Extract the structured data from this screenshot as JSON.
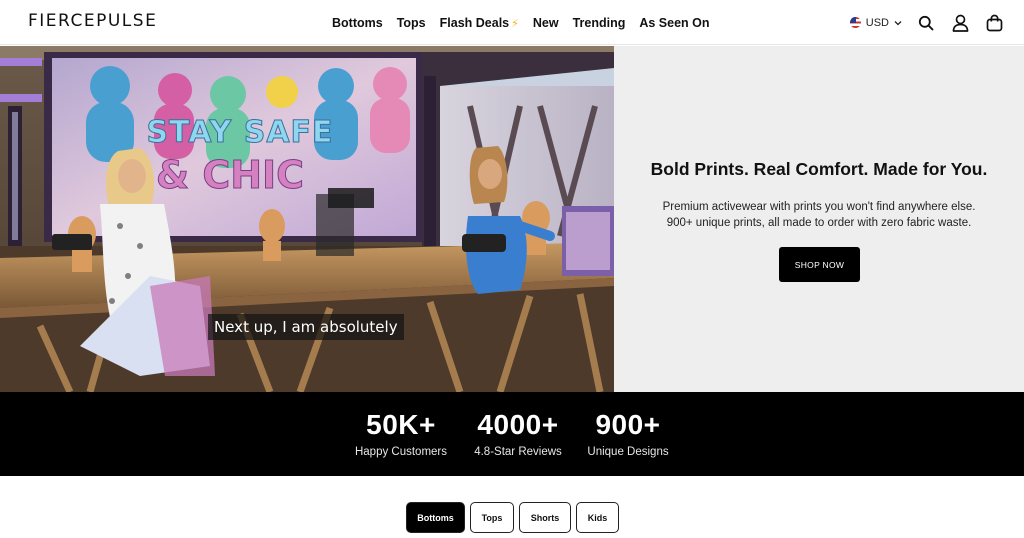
{
  "brand": {
    "logo_text": "FIERCEPULSE"
  },
  "nav": {
    "items": [
      {
        "label": "Bottoms"
      },
      {
        "label": "Tops"
      },
      {
        "label": "Flash Deals"
      },
      {
        "label": "New"
      },
      {
        "label": "Trending"
      },
      {
        "label": "As Seen On"
      }
    ],
    "flash_icon": "lightning-bolt-icon"
  },
  "utilities": {
    "currency": "USD",
    "icons": [
      "search-icon",
      "account-icon",
      "cart-icon"
    ]
  },
  "hero": {
    "video": {
      "backdrop_text_line1": "STAY SAFE",
      "backdrop_text_line2": "& CHIC",
      "caption": "Next up, I am absolutely"
    },
    "title": "Bold Prints. Real Comfort. Made for You.",
    "subtitle_line1": "Premium activewear with prints you won't find anywhere else.",
    "subtitle_line2": "900+ unique prints, all made to order with zero fabric waste.",
    "cta_label": "SHOP NOW"
  },
  "stats": [
    {
      "value": "50K+",
      "label": "Happy Customers"
    },
    {
      "value": "4000+",
      "label": "4.8-Star Reviews"
    },
    {
      "value": "900+",
      "label": "Unique Designs"
    }
  ],
  "categories": {
    "tabs": [
      {
        "label": "Bottoms",
        "active": true
      },
      {
        "label": "Tops",
        "active": false
      },
      {
        "label": "Shorts",
        "active": false
      },
      {
        "label": "Kids",
        "active": false
      }
    ]
  },
  "colors": {
    "accent": "#000000",
    "hero_panel": "#eeeeee",
    "flash_bolt": "#f5b50a"
  }
}
